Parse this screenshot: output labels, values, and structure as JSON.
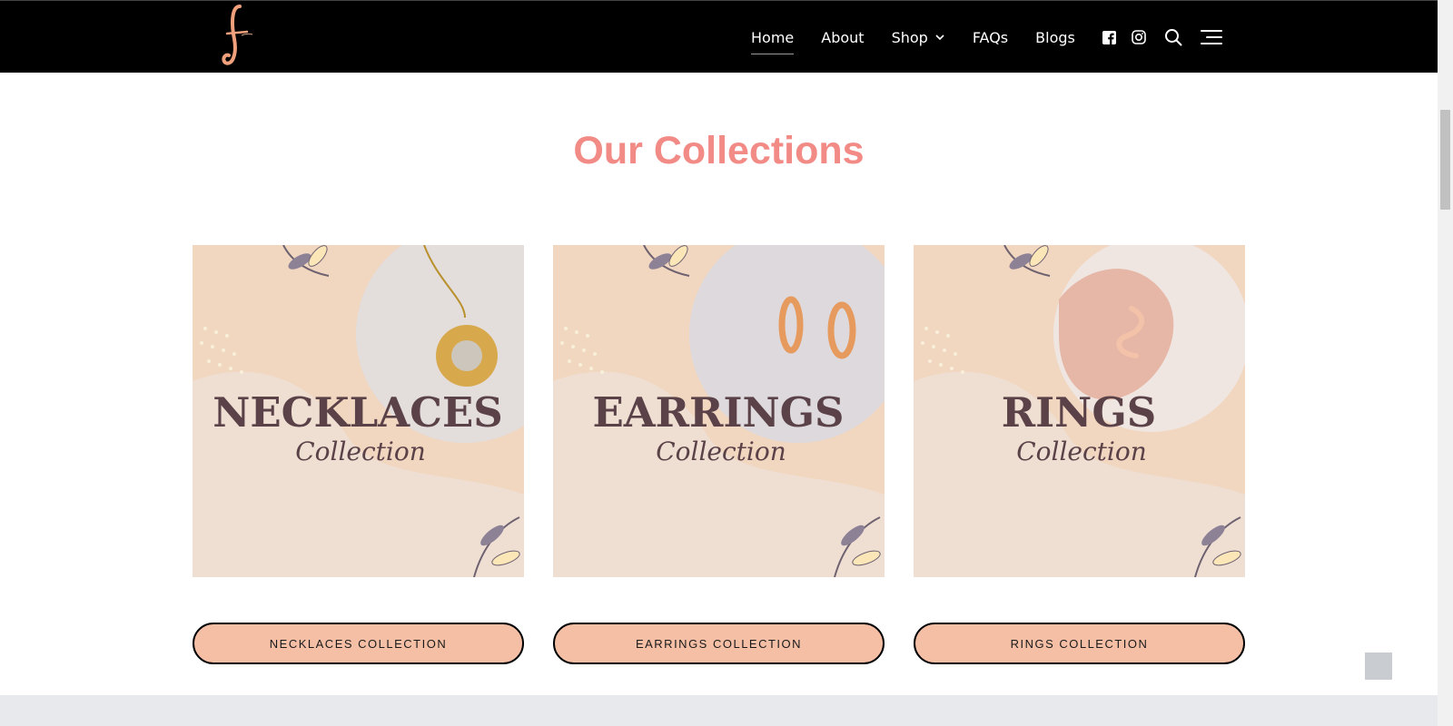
{
  "header": {
    "logo_icon": "script-f-logo-icon",
    "nav": [
      {
        "label": "Home",
        "active": true
      },
      {
        "label": "About",
        "active": false
      },
      {
        "label": "Shop",
        "active": false,
        "has_dropdown": true
      },
      {
        "label": "FAQs",
        "active": false
      },
      {
        "label": "Blogs",
        "active": false
      }
    ],
    "icons": [
      "facebook-icon",
      "instagram-icon",
      "search-icon",
      "menu-icon"
    ]
  },
  "section": {
    "title": "Our Collections"
  },
  "collections": [
    {
      "image_title": "NECKLACES",
      "image_subtitle": "Collection",
      "button_label": "NECKLACES COLLECTION"
    },
    {
      "image_title": "EARRINGS",
      "image_subtitle": "Collection",
      "button_label": "EARRINGS COLLECTION"
    },
    {
      "image_title": "RINGS",
      "image_subtitle": "Collection",
      "button_label": "RINGS COLLECTION"
    }
  ],
  "colors": {
    "header_bg": "#000000",
    "title": "#f28a86",
    "button_bg": "#f5bfa6",
    "card_bg": "#f1d6c0",
    "card_text": "#5a4248"
  }
}
